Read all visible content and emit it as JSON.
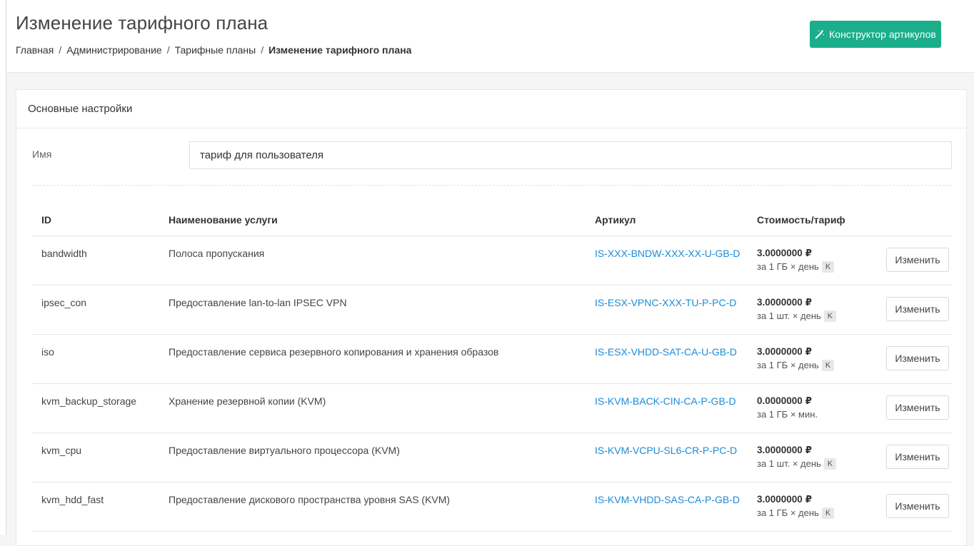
{
  "header": {
    "title": "Изменение тарифного плана",
    "breadcrumbs": [
      "Главная",
      "Администрирование",
      "Тарифные планы",
      "Изменение тарифного плана"
    ],
    "builder_button_label": "Конструктор артикулов",
    "builder_icon": "magic-wand-icon"
  },
  "colors": {
    "accent": "#1aae8a",
    "link": "#1a8cd8"
  },
  "settings": {
    "section_title": "Основные настройки",
    "name_label": "Имя",
    "name_value": "тариф для пользователя"
  },
  "table": {
    "columns": [
      "ID",
      "Наименование услуги",
      "Артикул",
      "Стоимость/тариф"
    ],
    "edit_label": "Изменить",
    "rows": [
      {
        "id": "bandwidth",
        "name": "Полоса пропускания",
        "sku": "IS-XXX-BNDW-XXX-XX-U-GB-D",
        "price": "3.0000000 ₽",
        "unit": "за 1 ГБ × день",
        "badge": "K"
      },
      {
        "id": "ipsec_con",
        "name": "Предоставление lan-to-lan IPSEC VPN",
        "sku": "IS-ESX-VPNC-XXX-TU-P-PC-D",
        "price": "3.0000000 ₽",
        "unit": "за 1 шт. × день",
        "badge": "K"
      },
      {
        "id": "iso",
        "name": "Предоставление сервиса резервного копирования и хранения образов",
        "sku": "IS-ESX-VHDD-SAT-CA-U-GB-D",
        "price": "3.0000000 ₽",
        "unit": "за 1 ГБ × день",
        "badge": "K"
      },
      {
        "id": "kvm_backup_storage",
        "name": "Хранение резервной копии (KVM)",
        "sku": "IS-KVM-BACK-CIN-CA-P-GB-D",
        "price": "0.0000000 ₽",
        "unit": "за 1 ГБ × мин.",
        "badge": ""
      },
      {
        "id": "kvm_cpu",
        "name": "Предоставление виртуального процессора (KVM)",
        "sku": "IS-KVM-VCPU-SL6-CR-P-PC-D",
        "price": "3.0000000 ₽",
        "unit": "за 1 шт. × день",
        "badge": "K"
      },
      {
        "id": "kvm_hdd_fast",
        "name": "Предоставление дискового пространства уровня SAS (KVM)",
        "sku": "IS-KVM-VHDD-SAS-CA-P-GB-D",
        "price": "3.0000000 ₽",
        "unit": "за 1 ГБ × день",
        "badge": "K"
      }
    ]
  }
}
